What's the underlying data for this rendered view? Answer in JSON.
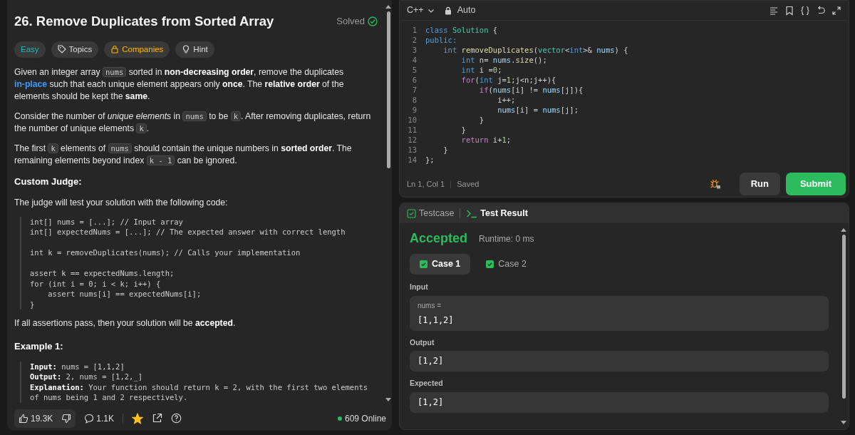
{
  "problem": {
    "title": "26. Remove Duplicates from Sorted Array",
    "status": "Solved",
    "solved": true,
    "tags": [
      {
        "label": "Easy",
        "kind": "difficulty"
      },
      {
        "label": "Topics",
        "kind": "topics"
      },
      {
        "label": "Companies",
        "kind": "companies"
      },
      {
        "label": "Hint",
        "kind": "hint"
      }
    ],
    "blocks": [
      {
        "kind": "paragraph",
        "segments": [
          {
            "kind": "text",
            "text": "Given an integer array "
          },
          {
            "kind": "code",
            "text": "nums"
          },
          {
            "kind": "text",
            "text": " sorted in "
          },
          {
            "kind": "bold",
            "text": "non-decreasing order"
          },
          {
            "kind": "text",
            "text": ", remove the duplicates "
          },
          {
            "kind": "link",
            "text": "in-place"
          },
          {
            "kind": "text",
            "text": " such that each unique element appears only "
          },
          {
            "kind": "bold",
            "text": "once"
          },
          {
            "kind": "text",
            "text": ". The "
          },
          {
            "kind": "bold",
            "text": "relative order"
          },
          {
            "kind": "text",
            "text": " of the elements should be kept the "
          },
          {
            "kind": "bold",
            "text": "same"
          },
          {
            "kind": "text",
            "text": "."
          }
        ]
      },
      {
        "kind": "paragraph",
        "segments": [
          {
            "kind": "text",
            "text": "Consider the number of "
          },
          {
            "kind": "italic",
            "text": "unique elements"
          },
          {
            "kind": "text",
            "text": " in "
          },
          {
            "kind": "code",
            "text": "nums"
          },
          {
            "kind": "text",
            "text": " to be "
          },
          {
            "kind": "code",
            "text": "k"
          },
          {
            "kind": "text",
            "text": ". After removing duplicates, return the number of unique elements "
          },
          {
            "kind": "code",
            "text": "k"
          },
          {
            "kind": "text",
            "text": "."
          }
        ]
      },
      {
        "kind": "paragraph",
        "segments": [
          {
            "kind": "text",
            "text": "The first "
          },
          {
            "kind": "code",
            "text": "k"
          },
          {
            "kind": "text",
            "text": " elements of "
          },
          {
            "kind": "code",
            "text": "nums"
          },
          {
            "kind": "text",
            "text": " should contain the unique numbers in "
          },
          {
            "kind": "bold",
            "text": "sorted order"
          },
          {
            "kind": "text",
            "text": ". The remaining elements beyond index "
          },
          {
            "kind": "code",
            "text": "k - 1"
          },
          {
            "kind": "text",
            "text": " can be ignored."
          }
        ]
      },
      {
        "kind": "heading",
        "text": "Custom Judge:"
      },
      {
        "kind": "paragraph",
        "segments": [
          {
            "kind": "text",
            "text": "The judge will test your solution with the following code:"
          }
        ]
      },
      {
        "kind": "code",
        "groups": [
          [
            "int[] nums = [...]; // Input array",
            "int[] expectedNums = [...]; // The expected answer with correct length"
          ],
          [
            "int k = removeDuplicates(nums); // Calls your implementation"
          ],
          [
            "assert k == expectedNums.length;",
            "for (int i = 0; i < k; i++) {",
            "    assert nums[i] == expectedNums[i];",
            "}"
          ]
        ]
      },
      {
        "kind": "paragraph",
        "segments": [
          {
            "kind": "text",
            "text": "If all assertions pass, then your solution will be "
          },
          {
            "kind": "bold",
            "text": "accepted"
          },
          {
            "kind": "text",
            "text": "."
          }
        ]
      },
      {
        "kind": "example_heading",
        "text": "Example 1:"
      },
      {
        "kind": "example",
        "lines": [
          "**Input:** nums = [1,1,2]",
          "**Output:** 2, nums = [1,2,_]",
          "**Explanation:** Your function should return k = 2, with the first two elements",
          "of nums being 1 and 2 respectively."
        ]
      }
    ]
  },
  "footer": {
    "likes": "19.3K",
    "comments": "1.1K",
    "favorited": true,
    "online": "609 Online"
  },
  "editor": {
    "language": "C++",
    "mode": "Auto",
    "lines": [
      {
        "number": "1",
        "tokens": [
          {
            "kind": "kw",
            "text": "class"
          },
          {
            "kind": "type",
            "text": " Solution"
          },
          {
            "kind": "plain",
            "text": " {"
          }
        ]
      },
      {
        "number": "2",
        "tokens": [
          {
            "kind": "kw",
            "text": "public:"
          }
        ]
      },
      {
        "number": "3",
        "tokens": [
          {
            "kind": "kw",
            "text": "    int"
          },
          {
            "kind": "fn",
            "text": " removeDuplicates"
          },
          {
            "kind": "plain",
            "text": "("
          },
          {
            "kind": "type",
            "text": "vector"
          },
          {
            "kind": "plain",
            "text": "<"
          },
          {
            "kind": "kw",
            "text": "int"
          },
          {
            "kind": "plain",
            "text": ">&"
          },
          {
            "kind": "var",
            "text": " nums"
          },
          {
            "kind": "plain",
            "text": ") {"
          }
        ]
      },
      {
        "number": "4",
        "tokens": [
          {
            "kind": "kw",
            "text": "        int"
          },
          {
            "kind": "plain",
            "text": " n= "
          },
          {
            "kind": "var",
            "text": "nums"
          },
          {
            "kind": "plain",
            "text": "."
          },
          {
            "kind": "fn",
            "text": "size"
          },
          {
            "kind": "plain",
            "text": "();"
          }
        ]
      },
      {
        "number": "5",
        "tokens": [
          {
            "kind": "kw",
            "text": "        int"
          },
          {
            "kind": "plain",
            "text": " i ="
          },
          {
            "kind": "num",
            "text": "0"
          },
          {
            "kind": "plain",
            "text": ";"
          }
        ]
      },
      {
        "number": "6",
        "tokens": [
          {
            "kind": "ctl",
            "text": "        for"
          },
          {
            "kind": "plain",
            "text": "("
          },
          {
            "kind": "kw",
            "text": "int"
          },
          {
            "kind": "plain",
            "text": " j="
          },
          {
            "kind": "num",
            "text": "1"
          },
          {
            "kind": "plain",
            "text": ";j<n;j++){"
          }
        ]
      },
      {
        "number": "7",
        "tokens": [
          {
            "kind": "ctl",
            "text": "            if"
          },
          {
            "kind": "plain",
            "text": "("
          },
          {
            "kind": "var",
            "text": "nums"
          },
          {
            "kind": "plain",
            "text": "[i] != "
          },
          {
            "kind": "var",
            "text": "nums"
          },
          {
            "kind": "plain",
            "text": "[j]){"
          }
        ]
      },
      {
        "number": "8",
        "tokens": [
          {
            "kind": "plain",
            "text": "                i++;"
          }
        ]
      },
      {
        "number": "9",
        "tokens": [
          {
            "kind": "var",
            "text": "                nums"
          },
          {
            "kind": "plain",
            "text": "[i] = "
          },
          {
            "kind": "var",
            "text": "nums"
          },
          {
            "kind": "plain",
            "text": "[j];"
          }
        ]
      },
      {
        "number": "10",
        "tokens": [
          {
            "kind": "plain",
            "text": "            }"
          }
        ]
      },
      {
        "number": "11",
        "tokens": [
          {
            "kind": "plain",
            "text": "        }"
          }
        ]
      },
      {
        "number": "12",
        "tokens": [
          {
            "kind": "ctl",
            "text": "        return"
          },
          {
            "kind": "plain",
            "text": " i+"
          },
          {
            "kind": "num",
            "text": "1"
          },
          {
            "kind": "plain",
            "text": ";"
          }
        ]
      },
      {
        "number": "13",
        "tokens": [
          {
            "kind": "plain",
            "text": "    }"
          }
        ]
      },
      {
        "number": "14",
        "tokens": [
          {
            "kind": "plain",
            "text": "};"
          }
        ]
      }
    ],
    "position": "Ln 1, Col 1",
    "save_state": "Saved",
    "run": "Run",
    "submit": "Submit"
  },
  "console": {
    "tabs": [
      {
        "label": "Testcase",
        "kind": "testcase",
        "selected": false
      },
      {
        "label": "Test Result",
        "kind": "result",
        "selected": true
      }
    ],
    "verdict": "Accepted",
    "runtime": "Runtime: 0 ms",
    "cases": [
      {
        "label": "Case 1",
        "passed": true,
        "selected": true
      },
      {
        "label": "Case 2",
        "passed": true,
        "selected": false
      }
    ],
    "sections": [
      {
        "heading": "Input",
        "name": "nums =",
        "value": "[1,1,2]"
      },
      {
        "heading": "Output",
        "value": "[1,2]"
      },
      {
        "heading": "Expected",
        "value": "[1,2]"
      }
    ]
  }
}
